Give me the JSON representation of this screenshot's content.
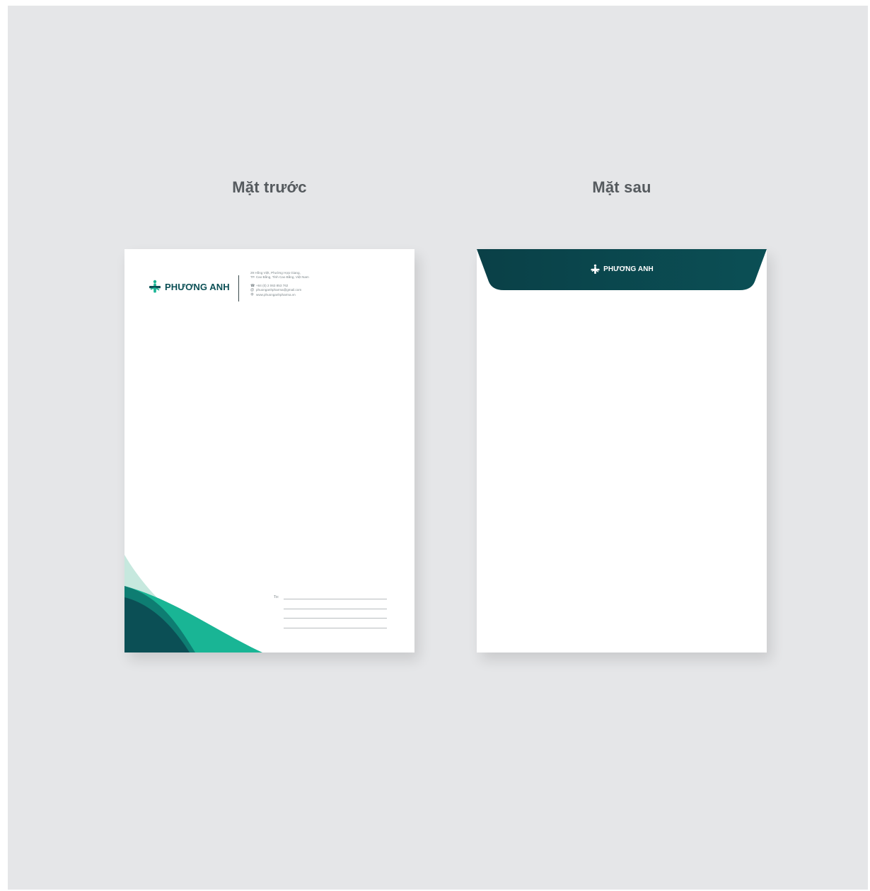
{
  "labels": {
    "front": "Mặt trước",
    "back": "Mặt sau"
  },
  "brand": {
    "name": "PHƯƠNG ANH",
    "primary_color": "#0b4f55",
    "accent_color": "#19b595"
  },
  "contact": {
    "address_line1": "29 Hồng Việt, Phường Hợp Giang,",
    "address_line2": "TP. Cao Bằng, Tỉnh Cao Bằng, Việt Nam",
    "phone": "+84 (0) 2 063 853 762",
    "email": "phuonganhpharma@gmail.com",
    "website": "www.phuonganhpharma.vn"
  },
  "recipient": {
    "to_label": "To:"
  }
}
